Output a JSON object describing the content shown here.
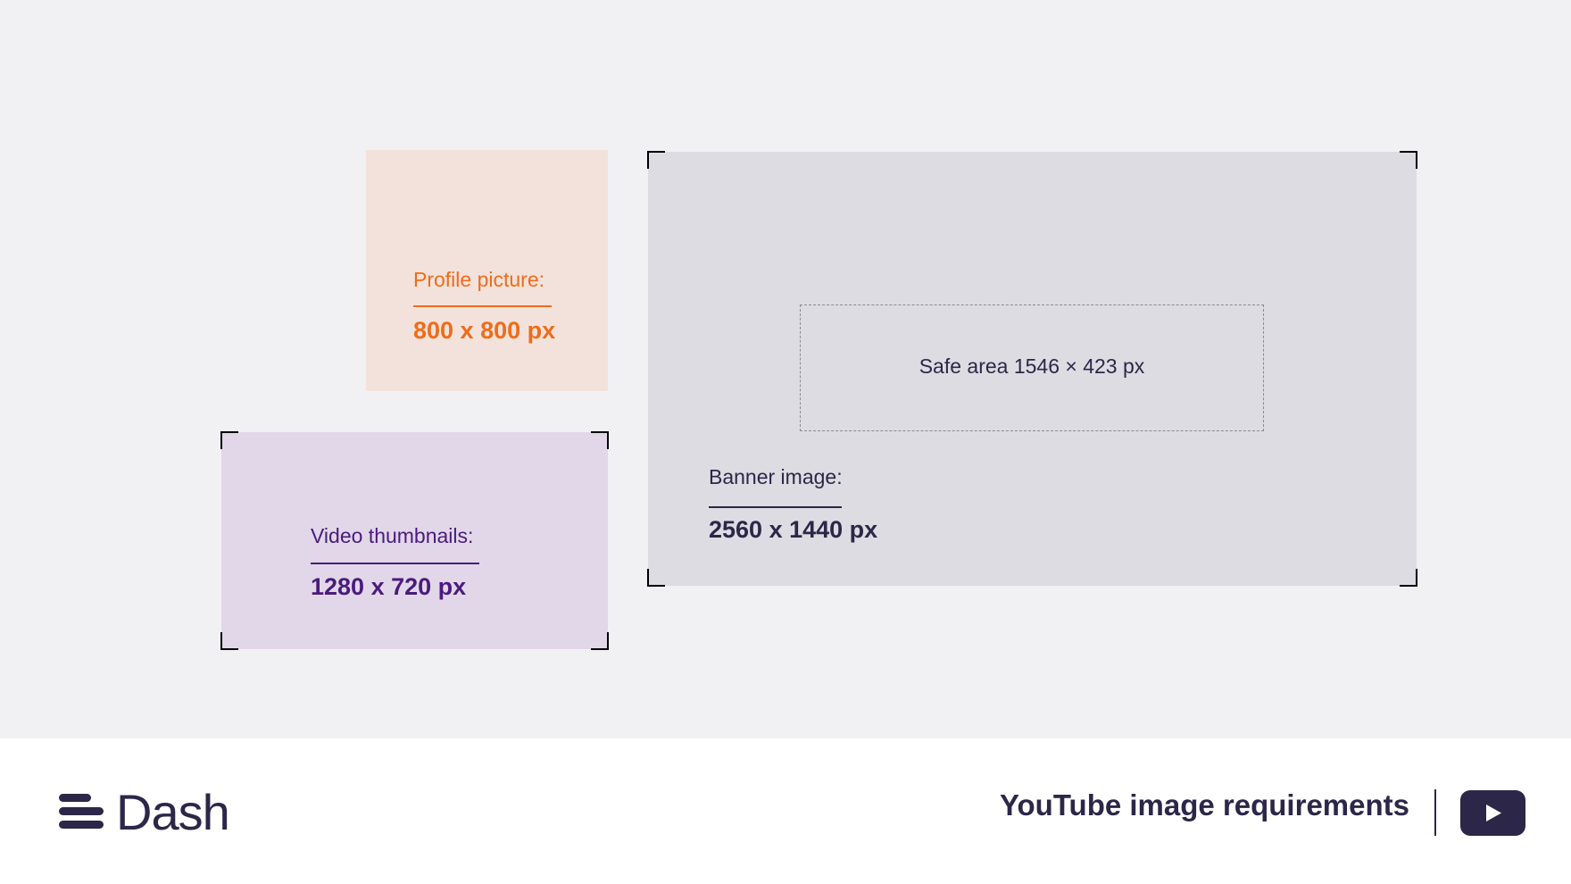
{
  "profile": {
    "label": "Profile picture:",
    "size": "800 x 800 px"
  },
  "thumbnails": {
    "label": "Video thumbnails:",
    "size": "1280 x 720 px"
  },
  "banner": {
    "label": "Banner image:",
    "size": "2560 x 1440 px",
    "safe_area": "Safe area 1546 × 423 px"
  },
  "footer": {
    "brand": "Dash",
    "title": "YouTube image requirements",
    "icon": "youtube-play-icon"
  },
  "colors": {
    "background": "#f1f1f4",
    "profile_fill": "#f2e2db",
    "profile_accent": "#ef6c1a",
    "thumbnail_fill": "#e1d7e8",
    "thumbnail_accent": "#4a1b7d",
    "banner_fill": "#dddce2",
    "navy": "#2c2748"
  }
}
